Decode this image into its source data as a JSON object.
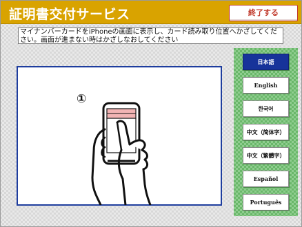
{
  "header": {
    "title": "証明書交付サービス",
    "end_button": "終了する"
  },
  "instruction": {
    "line1": "マイナンバーカードをiPhoneの画面に表示し、カード読み取り位置へかざしてくだ",
    "line2": "さい。画面が進まない時はかざしなおしてください"
  },
  "illustration": {
    "step_number": "①"
  },
  "languages": {
    "items": [
      {
        "label": "日本語",
        "selected": true
      },
      {
        "label": "English",
        "selected": false
      },
      {
        "label": "한국어",
        "selected": false
      },
      {
        "label": "中文（简体字）",
        "selected": false
      },
      {
        "label": "中文（繁體字）",
        "selected": false
      },
      {
        "label": "Español",
        "selected": false
      },
      {
        "label": "Português",
        "selected": false
      }
    ]
  },
  "colors": {
    "header": "#d9a300",
    "selected_language": "#17339a",
    "language_panel": "#6ab76a",
    "panel_border": "#1e3d9e",
    "end_button_text": "#c0392b"
  }
}
